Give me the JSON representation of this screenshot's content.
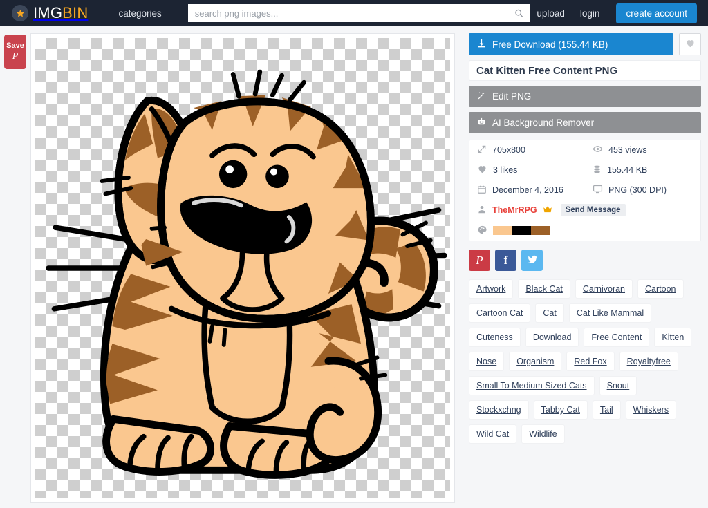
{
  "header": {
    "logo": {
      "badge_icon": "star-icon",
      "text_white": "IMG",
      "text_orange": "BIN"
    },
    "categories_label": "categories",
    "search": {
      "placeholder": "search png images...",
      "value": "",
      "icon": "search-icon"
    },
    "upload_label": "upload",
    "login_label": "login",
    "create_account_label": "create account",
    "bg_color": "#1c2433",
    "accent_color": "#f5a623"
  },
  "rail": {
    "pinterest_save": {
      "label": "Save",
      "glyph": "P",
      "icon": "pinterest-icon",
      "color": "#c9434e"
    }
  },
  "stage": {
    "alt": "Cartoon tabby cat kitten illustration on transparent checkerboard background"
  },
  "sidebar": {
    "download_button": {
      "label": "Free Download (155.44 KB)",
      "icon": "download-icon",
      "color": "#1a86d0"
    },
    "favorite_button": {
      "icon": "heart-icon"
    },
    "title": "Cat Kitten Free Content PNG",
    "edit_button": {
      "label": "Edit PNG",
      "icon": "magic-wand-icon"
    },
    "ai_bg_button": {
      "label": "AI Background Remover",
      "icon": "robot-icon"
    },
    "meta": [
      [
        {
          "icon": "resize-icon",
          "value": "705x800"
        },
        {
          "icon": "eye-icon",
          "value": "453 views"
        }
      ],
      [
        {
          "icon": "heart-icon",
          "value": "3 likes"
        },
        {
          "icon": "database-icon",
          "value": "155.44 KB"
        }
      ],
      [
        {
          "icon": "calendar-icon",
          "value": "December 4, 2016"
        },
        {
          "icon": "monitor-icon",
          "value": "PNG (300 DPI)"
        }
      ]
    ],
    "author": {
      "icon": "user-icon",
      "name": "TheMrRPG",
      "badge_icon": "crown-icon",
      "message_label": "Send Message"
    },
    "palette": {
      "icon": "palette-icon",
      "colors": [
        "#fac78f",
        "#000000",
        "#9c6027"
      ]
    },
    "social": [
      {
        "name": "pinterest",
        "glyph": "P",
        "icon": "pinterest-icon",
        "color": "#cb3b45"
      },
      {
        "name": "facebook",
        "glyph": "f",
        "icon": "facebook-icon",
        "color": "#3b5998"
      },
      {
        "name": "twitter",
        "glyph": "",
        "icon": "twitter-icon",
        "color": "#5bb8f0"
      }
    ],
    "tags": [
      "Artwork",
      "Black Cat",
      "Carnivoran",
      "Cartoon",
      "Cartoon Cat",
      "Cat",
      "Cat Like Mammal",
      "Cuteness",
      "Download",
      "Free Content",
      "Kitten",
      "Nose",
      "Organism",
      "Red Fox",
      "Royaltyfree",
      "Small To Medium Sized Cats",
      "Snout",
      "Stockxchng",
      "Tabby Cat",
      "Tail",
      "Whiskers",
      "Wild Cat",
      "Wildlife"
    ]
  }
}
